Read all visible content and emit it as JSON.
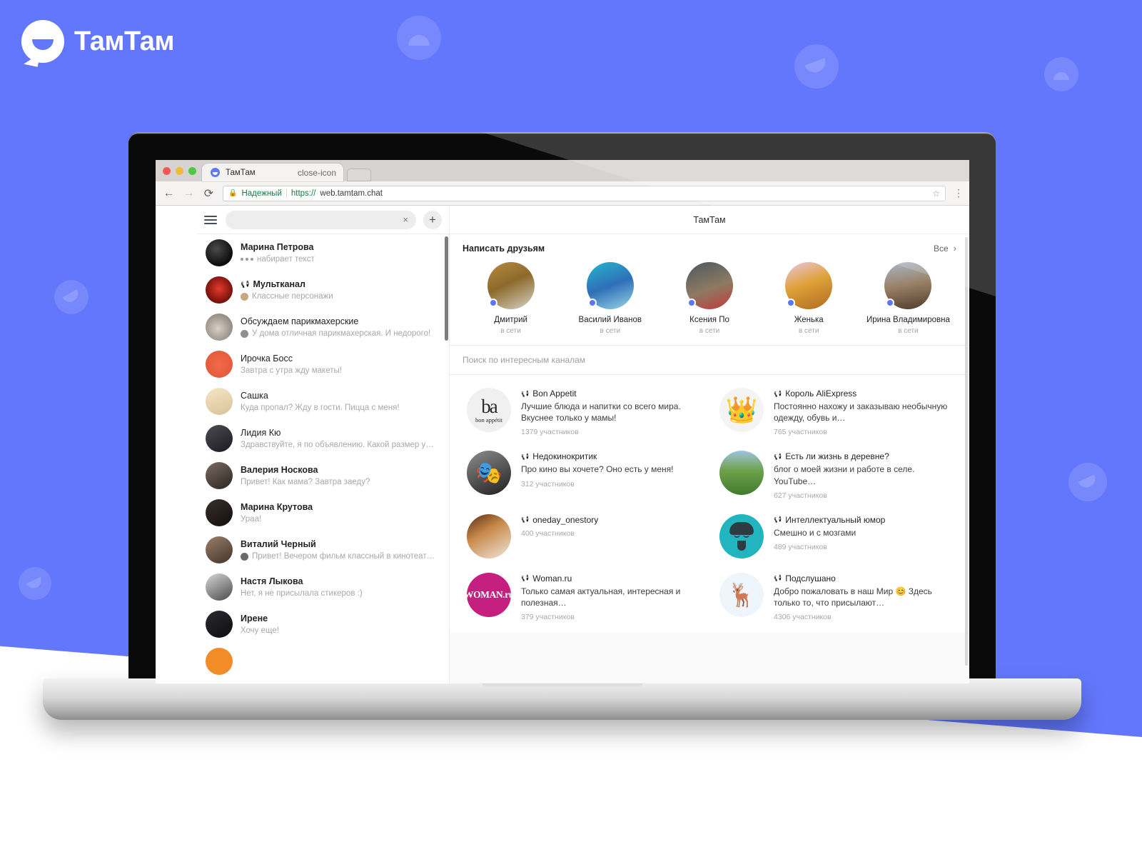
{
  "brand": {
    "name": "ТамТам",
    "logo_icon": "tamtam-speech-bubble-logo",
    "accent": "#6377fc"
  },
  "browser": {
    "tab_title": "ТамТам",
    "tab_close_icon": "close-icon",
    "new_tab_icon": "new-tab-icon",
    "back_icon": "←",
    "forward_icon": "→",
    "reload_icon": "⟳",
    "lock_icon": "🔒",
    "secure_label": "Надежный",
    "url_scheme": "https://",
    "url_rest": "web.tamtam.chat",
    "star_icon": "☆",
    "menu_icon": "⋮"
  },
  "sidebar": {
    "menu_icon": "hamburger-menu-icon",
    "search": {
      "value": "",
      "placeholder": "",
      "clear_icon": "×"
    },
    "new_chat_icon": "+",
    "chats": [
      {
        "title": "Марина Петрова",
        "bold": true,
        "preview": "набирает текст",
        "typing": true,
        "av": "g1"
      },
      {
        "title": "Мультканал",
        "bold": true,
        "channel": true,
        "preview": "Классные персонажи",
        "mini_av": "#c9a77f",
        "av": "g2"
      },
      {
        "title": "Обсуждаем парикмахерские",
        "bold": false,
        "preview": "У дома отличная парикмахерская. И недорого!",
        "mini_av": "#8f8f8f",
        "av": "g3"
      },
      {
        "title": "Ирочка Босс",
        "bold": false,
        "preview": "Завтра с утра жду макеты!",
        "av": "g4"
      },
      {
        "title": "Сашка",
        "bold": false,
        "preview": "Куда пропал? Жду в гости. Пицца с меня!",
        "av": "g5"
      },
      {
        "title": "Лидия Кю",
        "bold": false,
        "preview": "Здравствуйте, я по объявлению. Какой размер у…",
        "av": "g6"
      },
      {
        "title": "Валерия Носкова",
        "bold": true,
        "preview": "Привет! Как мама? Завтра заеду?",
        "av": "g7"
      },
      {
        "title": "Марина Крутова",
        "bold": true,
        "preview": "Ураа!",
        "av": "g8"
      },
      {
        "title": "Виталий Черный",
        "bold": true,
        "preview": "Привет! Вечером фильм классный в кинотеатре…",
        "mini_av": "#6b6b6b",
        "av": "g9"
      },
      {
        "title": "Настя Лыкова",
        "bold": true,
        "preview": "Нет, я не присылала стикеров :)",
        "av": "g10"
      },
      {
        "title": "Ирене",
        "bold": true,
        "preview": "Хочу еще!",
        "av": "g11"
      }
    ]
  },
  "main": {
    "header_title": "ТамТам",
    "friends": {
      "title": "Написать друзьям",
      "all_label": "Все",
      "all_chevron": "›",
      "people": [
        {
          "name": "Дмитрий",
          "status": "в сети",
          "av": "p1"
        },
        {
          "name": "Василий Иванов",
          "status": "в сети",
          "av": "p2"
        },
        {
          "name": "Ксения По",
          "status": "в сети",
          "av": "p3"
        },
        {
          "name": "Женька",
          "status": "в сети",
          "av": "p4"
        },
        {
          "name": "Ирина Владимировна",
          "status": "в сети",
          "av": "p5"
        }
      ]
    },
    "channel_search_placeholder": "Поиск по интересным каналам",
    "channels": [
      {
        "name": "Bon Appetit",
        "desc": "Лучшие блюда и напитки со всего мира. Вкуснее только у мамы!",
        "members": "1379 участников",
        "icon": "bon"
      },
      {
        "name": "Король AliExpress",
        "desc": "Постоянно нахожу и заказываю необычную одежду, обувь и…",
        "members": "765 участников",
        "icon": "crown"
      },
      {
        "name": "Недокинокритик",
        "desc": "Про кино вы хочете? Оно есть у меня!",
        "members": "312 участников",
        "icon": "film"
      },
      {
        "name": "Есть ли жизнь в деревне?",
        "desc": "блог о моей жизни и работе в селе. YouTube…",
        "members": "627 участников",
        "icon": "field"
      },
      {
        "name": "oneday_onestory",
        "desc": "",
        "members": "400 участников",
        "icon": "oneday"
      },
      {
        "name": "Интеллектуальный юмор",
        "desc": "Смешно и с мозгами",
        "members": "489 участников",
        "icon": "teal"
      },
      {
        "name": "Woman.ru",
        "desc": "Только самая актуальная, интересная и полезная…",
        "members": "379 участников",
        "icon": "woman"
      },
      {
        "name": "Подслушано",
        "desc": "Добро пожаловать в наш Мир 😊 Здесь только то, что присылают…",
        "members": "4306 участников",
        "icon": "deer"
      }
    ]
  }
}
